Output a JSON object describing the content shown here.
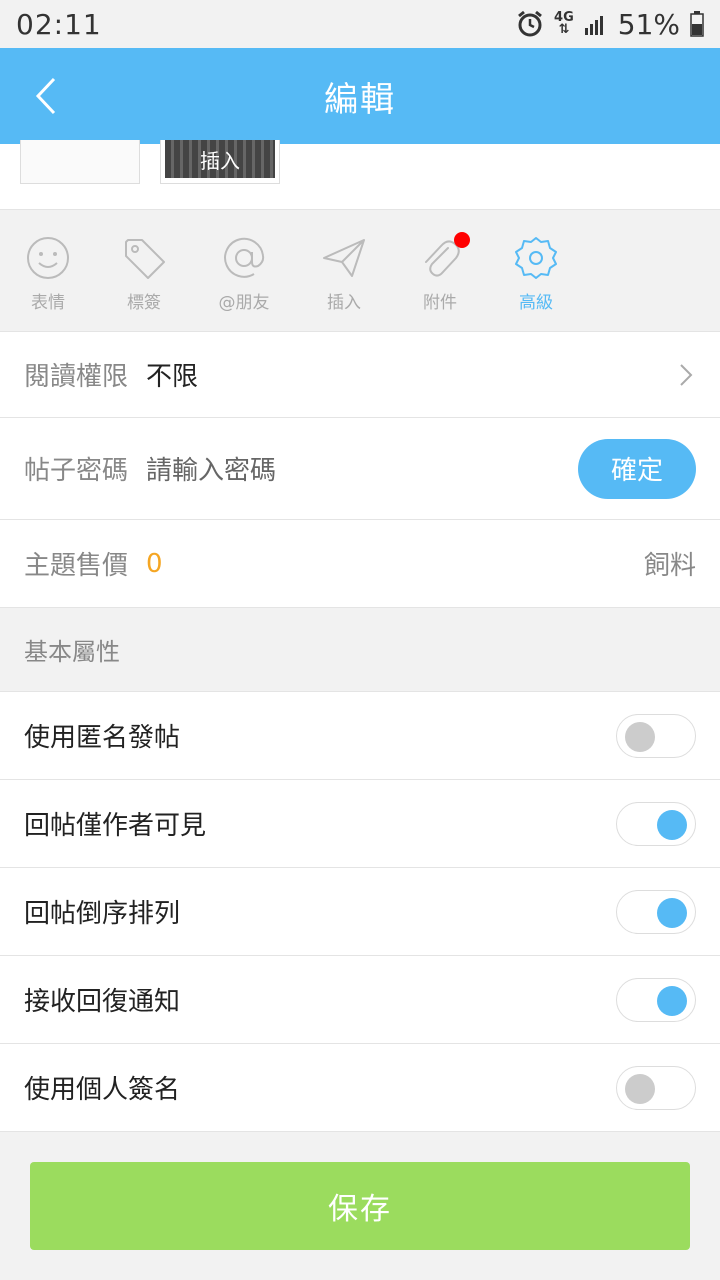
{
  "status_bar": {
    "time": "02:11",
    "network_type": "4G",
    "battery_text": "51%"
  },
  "header": {
    "title": "編輯"
  },
  "media": {
    "insert_label": "插入"
  },
  "toolbar": {
    "items": [
      {
        "label": "表情",
        "icon": "smiley-icon"
      },
      {
        "label": "標簽",
        "icon": "tag-icon"
      },
      {
        "label": "@朋友",
        "icon": "at-icon"
      },
      {
        "label": "插入",
        "icon": "send-icon"
      },
      {
        "label": "附件",
        "icon": "paperclip-icon"
      },
      {
        "label": "高級",
        "icon": "gear-icon"
      }
    ]
  },
  "read_permission": {
    "label": "閱讀權限",
    "value": "不限"
  },
  "post_password": {
    "label": "帖子密碼",
    "placeholder": "請輸入密碼",
    "confirm_label": "確定"
  },
  "topic_price": {
    "label": "主題售價",
    "value": "0",
    "unit": "飼料"
  },
  "basic_section": {
    "title": "基本屬性"
  },
  "toggles": [
    {
      "label": "使用匿名發帖",
      "on": false
    },
    {
      "label": "回帖僅作者可見",
      "on": true
    },
    {
      "label": "回帖倒序排列",
      "on": true
    },
    {
      "label": "接收回復通知",
      "on": true
    },
    {
      "label": "使用個人簽名",
      "on": false
    }
  ],
  "footer": {
    "save_label": "保存"
  },
  "colors": {
    "accent": "#56baf5",
    "save": "#9bdc5e",
    "price": "#f5a623",
    "badge": "#ff0000"
  }
}
